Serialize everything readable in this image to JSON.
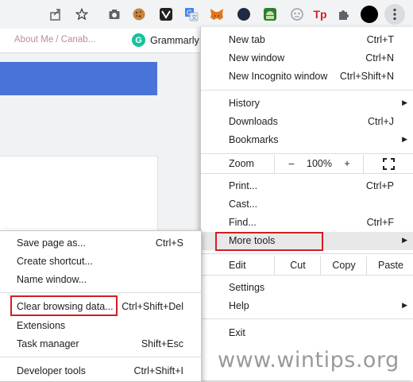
{
  "toolbar": {
    "icons": [
      "share-icon",
      "star-icon",
      "camera-icon",
      "cookie-extension-icon",
      "vpn-extension-icon",
      "translate-extension-icon",
      "metamask-icon",
      "orange-extension-icon",
      "android-extension-icon",
      "robot-extension-icon",
      "tp-extension-icon",
      "puzzle-extension-icon",
      "profile-avatar",
      "kebab-menu-icon"
    ],
    "tp_label": "Tp"
  },
  "bookmarks": {
    "item1": "About Me / Canab...",
    "item2": "Grammarly"
  },
  "main_menu": {
    "new_tab": {
      "label": "New tab",
      "shortcut": "Ctrl+T"
    },
    "new_window": {
      "label": "New window",
      "shortcut": "Ctrl+N"
    },
    "new_incognito": {
      "label": "New Incognito window",
      "shortcut": "Ctrl+Shift+N"
    },
    "history": {
      "label": "History"
    },
    "downloads": {
      "label": "Downloads",
      "shortcut": "Ctrl+J"
    },
    "bookmarks": {
      "label": "Bookmarks"
    },
    "zoom": {
      "label": "Zoom",
      "minus": "–",
      "value": "100%",
      "plus": "+"
    },
    "print": {
      "label": "Print...",
      "shortcut": "Ctrl+P"
    },
    "cast": {
      "label": "Cast..."
    },
    "find": {
      "label": "Find...",
      "shortcut": "Ctrl+F"
    },
    "more_tools": {
      "label": "More tools"
    },
    "edit": {
      "label": "Edit",
      "cut": "Cut",
      "copy": "Copy",
      "paste": "Paste"
    },
    "settings": {
      "label": "Settings"
    },
    "help": {
      "label": "Help"
    },
    "exit": {
      "label": "Exit"
    }
  },
  "sub_menu": {
    "save_page": {
      "label": "Save page as...",
      "shortcut": "Ctrl+S"
    },
    "create_shortcut": {
      "label": "Create shortcut..."
    },
    "name_window": {
      "label": "Name window..."
    },
    "clear_data": {
      "label": "Clear browsing data...",
      "shortcut": "Ctrl+Shift+Del"
    },
    "extensions": {
      "label": "Extensions"
    },
    "task_manager": {
      "label": "Task manager",
      "shortcut": "Shift+Esc"
    },
    "dev_tools": {
      "label": "Developer tools",
      "shortcut": "Ctrl+Shift+I"
    }
  },
  "watermark": "www.wintips.org",
  "colors": {
    "highlight_border": "#d21e24",
    "banner": "#4a73d9",
    "toolbar_bg": "#f1f3f4"
  }
}
